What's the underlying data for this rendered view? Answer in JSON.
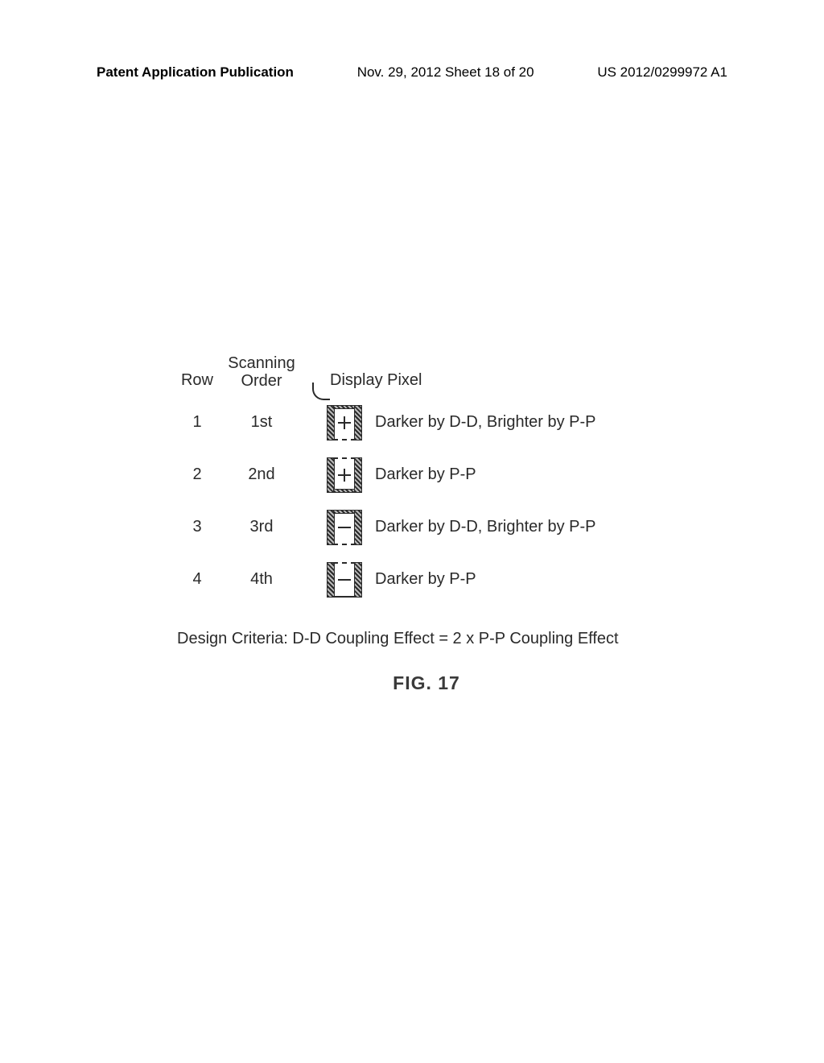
{
  "header": {
    "left": "Patent Application Publication",
    "center": "Nov. 29, 2012  Sheet 18 of 20",
    "right": "US 2012/0299972 A1"
  },
  "columns": {
    "row": "Row",
    "order_line1": "Scanning",
    "order_line2": "Order",
    "pixel": "Display Pixel"
  },
  "rows": [
    {
      "row": "1",
      "order": "1st",
      "sign": "plus",
      "top": "hatched",
      "bottom": "dashed",
      "desc": "Darker by D-D, Brighter by P-P"
    },
    {
      "row": "2",
      "order": "2nd",
      "sign": "plus",
      "top": "dashed",
      "bottom": "hatched",
      "desc": "Darker by P-P"
    },
    {
      "row": "3",
      "order": "3rd",
      "sign": "minus",
      "top": "hatched",
      "bottom": "dashed",
      "desc": "Darker by D-D, Brighter by P-P"
    },
    {
      "row": "4",
      "order": "4th",
      "sign": "minus",
      "top": "dashed",
      "bottom": "solid",
      "desc": "Darker by P-P"
    }
  ],
  "criteria": "Design Criteria: D-D Coupling Effect = 2 x P-P Coupling Effect",
  "figure_label": "FIG. 17"
}
